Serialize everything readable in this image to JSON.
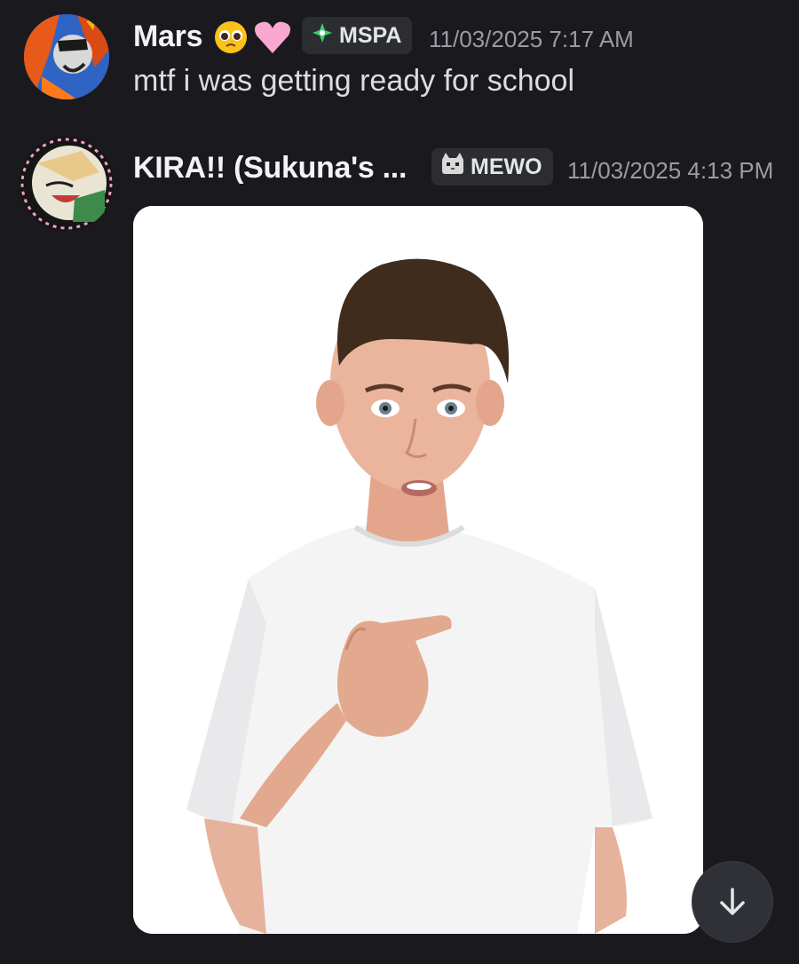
{
  "messages": [
    {
      "author": "Mars",
      "role_tag": "MSPA",
      "timestamp": "11/03/2025 7:17 AM",
      "content": "mtf i was getting ready for school",
      "avatar_icon": "avatar-mars"
    },
    {
      "author": "KIRA!! (Sukuna's ...",
      "role_tag": "MEWO",
      "timestamp": "11/03/2025 4:13 PM",
      "content": "",
      "avatar_icon": "avatar-kira",
      "attachment": "image-attachment"
    }
  ],
  "scroll_button": {
    "icon": "arrow-down-icon"
  },
  "colors": {
    "background": "#1a1a1e",
    "tag_background": "#2b2d31",
    "timestamp": "#9a9ca4",
    "text": "#dcdde1"
  }
}
